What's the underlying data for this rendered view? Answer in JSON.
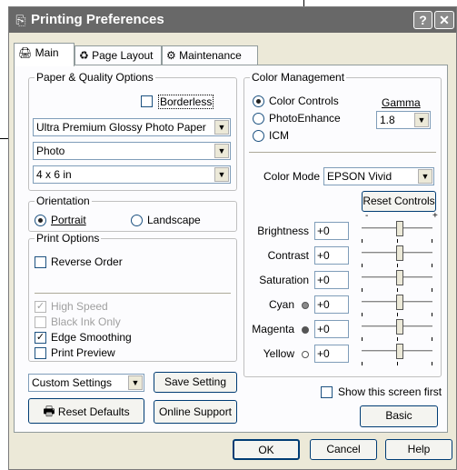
{
  "window": {
    "title": "Printing Preferences",
    "help_label": "?",
    "close_label": "✕"
  },
  "tabs": [
    {
      "label": "Main",
      "icon": "printer-icon"
    },
    {
      "label": "Page Layout",
      "icon": "page-layout-icon"
    },
    {
      "label": "Maintenance",
      "icon": "maintenance-icon"
    }
  ],
  "paper_quality": {
    "group_label": "Paper & Quality Options",
    "borderless_label": "Borderless",
    "borderless_checked": false,
    "media_type": "Ultra Premium Glossy Photo Paper",
    "quality": "Photo",
    "paper_size": "4 x 6 in"
  },
  "orientation": {
    "group_label": "Orientation",
    "portrait_label": "Portrait",
    "landscape_label": "Landscape",
    "selected": "Portrait"
  },
  "print_options": {
    "group_label": "Print Options",
    "reverse_order": {
      "label": "Reverse Order",
      "checked": false,
      "enabled": true
    },
    "high_speed": {
      "label": "High Speed",
      "checked": true,
      "enabled": false
    },
    "black_ink_only": {
      "label": "Black Ink Only",
      "checked": false,
      "enabled": false
    },
    "edge_smoothing": {
      "label": "Edge Smoothing",
      "checked": true,
      "enabled": true
    },
    "print_preview": {
      "label": "Print Preview",
      "checked": false,
      "enabled": true
    }
  },
  "custom_settings": {
    "value": "Custom Settings",
    "save_label": "Save Setting"
  },
  "reset_defaults_label": "Reset Defaults",
  "online_support_label": "Online Support",
  "color_management": {
    "group_label": "Color Management",
    "options": [
      "Color Controls",
      "PhotoEnhance",
      "ICM"
    ],
    "selected": "Color Controls",
    "gamma_label": "Gamma",
    "gamma_value": "1.8",
    "color_mode_label": "Color Mode",
    "color_mode_value": "EPSON Vivid",
    "reset_controls_label": "Reset Controls",
    "slider_min_label": "-",
    "slider_max_label": "+",
    "adjustments": [
      {
        "label": "Brightness",
        "value": "+0",
        "dot": null,
        "level": 0.5
      },
      {
        "label": "Contrast",
        "value": "+0",
        "dot": null,
        "level": 0.5
      },
      {
        "label": "Saturation",
        "value": "+0",
        "dot": null,
        "level": 0.5
      },
      {
        "label": "Cyan",
        "value": "+0",
        "dot": "#8a8a8a",
        "level": 0.5
      },
      {
        "label": "Magenta",
        "value": "+0",
        "dot": "#555555",
        "level": 0.5
      },
      {
        "label": "Yellow",
        "value": "+0",
        "dot": "#ffffff",
        "level": 0.5
      }
    ]
  },
  "show_screen_first": {
    "label": "Show this screen first",
    "checked": false
  },
  "basic_label": "Basic",
  "footer": {
    "ok_label": "OK",
    "cancel_label": "Cancel",
    "help_label": "Help"
  }
}
